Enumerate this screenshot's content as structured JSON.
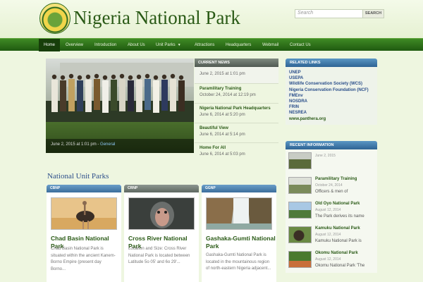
{
  "header": {
    "site_title": "Nigeria National Park",
    "logo_alt": "Nigeria National Parks",
    "search_placeholder": "Search",
    "search_button": "SEARCH"
  },
  "nav": {
    "items": [
      {
        "label": "Home",
        "active": true
      },
      {
        "label": "Overview"
      },
      {
        "label": "Introduction"
      },
      {
        "label": "About Us"
      },
      {
        "label": "Unit Parks",
        "has_dropdown": true
      },
      {
        "label": "Attractions"
      },
      {
        "label": "Headquarters"
      },
      {
        "label": "Webmail"
      },
      {
        "label": "Contact Us"
      }
    ]
  },
  "slider": {
    "caption_date": "June 2, 2015 at 1:01 pm - ",
    "caption_category": "General"
  },
  "current_news": {
    "header": "CURRENT NEWS",
    "items": [
      {
        "title": "",
        "date": "June 2, 2015 at 1:01 pm"
      },
      {
        "title": "Paramilitary Training",
        "date": "October 24, 2014 at 12:19 pm"
      },
      {
        "title": "Nigeria National Park Headquarters",
        "date": "June 6, 2014 at 5:20 pm"
      },
      {
        "title": "Beautiful View",
        "date": "June 6, 2014 at 5:14 pm"
      },
      {
        "title": "Home For All",
        "date": "June 6, 2014 at 5:03 pm"
      }
    ]
  },
  "unit_parks": {
    "section_title": "National Unit Parks",
    "cards": [
      {
        "tab": "CBNP",
        "title": "Chad Basin National Park",
        "text": [
          "Chad Basin National Park is",
          "situated within the ancient Kanem-",
          "Borno Empire (present day",
          "Borno..."
        ]
      },
      {
        "tab": "CRNP",
        "title": "Cross River National Park",
        "text": [
          "Location and Size: Cross River",
          "National Park is located between",
          "Latitude 5o 05' and 6o 29'..."
        ]
      },
      {
        "tab": "GGNP",
        "title": "Gashaka-Gumti National Park",
        "text": [
          "Gashaka-Gumti National Park is",
          "located in the mountainous region",
          "of north-eastern Nigeria adjacent..."
        ]
      }
    ]
  },
  "related_links": {
    "header": "RELATED LINKS",
    "items": [
      "UNEP",
      "USEPA",
      "Wildlife Conservation Society (WCS)",
      "Nigeria Conservation Foundation (NCF)",
      "FMEnv",
      "NOSDRA",
      "FRIN",
      "NESREA",
      "www.panthera.org"
    ]
  },
  "recent_info": {
    "header": "RECENT INFORMATION",
    "items": [
      {
        "title": "",
        "date": "June 2, 2015",
        "excerpt": ""
      },
      {
        "title": "Paramilitary Training",
        "date": "October 24, 2014",
        "excerpt": "Officers & men of"
      },
      {
        "title": "Old Oyo National Park",
        "date": "August 12, 2014",
        "excerpt": "The Park derives its name"
      },
      {
        "title": "Kamuku National Park",
        "date": "August 12, 2014",
        "excerpt": "Kamuku National Park is"
      },
      {
        "title": "Okomu National Park",
        "date": "August 12, 2014",
        "excerpt": "Okomu National Park 'The"
      }
    ]
  },
  "colors": {
    "nav_green": "#1f5a10",
    "accent_blue": "#2e6494",
    "title_green": "#2a5a16"
  }
}
